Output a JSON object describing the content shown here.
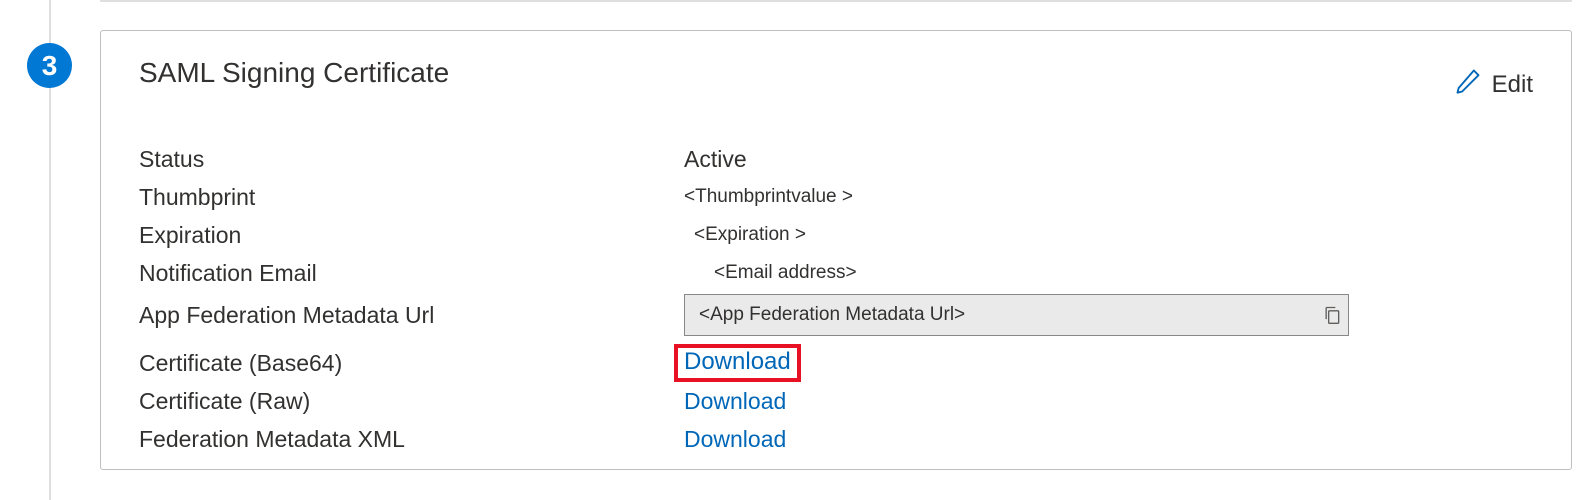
{
  "step": {
    "number": "3"
  },
  "card": {
    "title": "SAML Signing Certificate",
    "editLabel": "Edit",
    "fields": {
      "status": {
        "label": "Status",
        "value": "Active"
      },
      "thumbprint": {
        "label": "Thumbprint",
        "value": "<Thumbprintvalue >"
      },
      "expiration": {
        "label": "Expiration",
        "value": "<Expiration >"
      },
      "notificationEmail": {
        "label": "Notification Email",
        "value": "<Email address>"
      },
      "metadataUrl": {
        "label": "App Federation Metadata Url",
        "value": "<App Federation Metadata Url>"
      },
      "certBase64": {
        "label": "Certificate (Base64)",
        "action": "Download"
      },
      "certRaw": {
        "label": "Certificate (Raw)",
        "action": "Download"
      },
      "fedXml": {
        "label": "Federation Metadata XML",
        "action": "Download"
      }
    }
  }
}
